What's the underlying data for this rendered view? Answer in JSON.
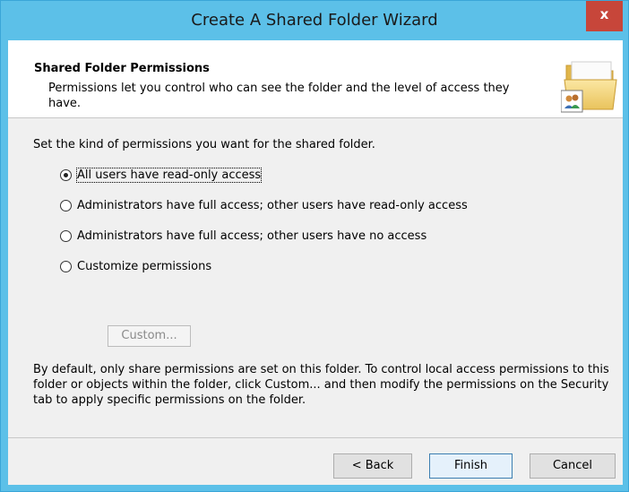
{
  "window": {
    "title": "Create A Shared Folder Wizard",
    "close_label": "x"
  },
  "header": {
    "title": "Shared Folder Permissions",
    "description": "Permissions let you control who can see the folder and the level of access they have."
  },
  "content": {
    "prompt": "Set the kind of permissions you want for the shared folder.",
    "options": [
      {
        "label": "All users have read-only access",
        "checked": true
      },
      {
        "label": "Administrators have full access; other users have read-only access",
        "checked": false
      },
      {
        "label": "Administrators have full access; other users have no access",
        "checked": false
      },
      {
        "label": "Customize permissions",
        "checked": false
      }
    ],
    "custom_button": "Custom...",
    "info": "By default, only share permissions are set on this folder. To control local access permissions to this folder or objects within the folder, click Custom... and then modify the permissions on the Security tab to apply specific permissions on the folder."
  },
  "footer": {
    "back_label": "< Back",
    "finish_label": "Finish",
    "cancel_label": "Cancel"
  }
}
